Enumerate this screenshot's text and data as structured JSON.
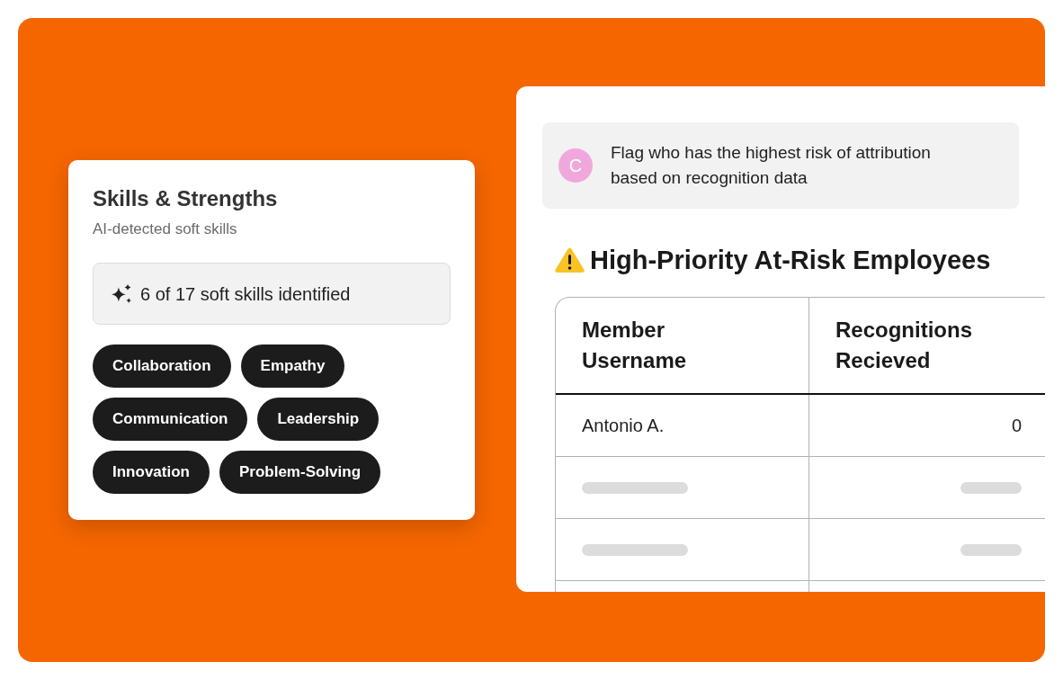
{
  "skills_card": {
    "title": "Skills & Strengths",
    "subtitle": "AI-detected soft skills",
    "summary": "6 of 17 soft skills identified",
    "skills": [
      "Collaboration",
      "Empathy",
      "Communication",
      "Leadership",
      "Innovation",
      "Problem-Solving"
    ]
  },
  "report_panel": {
    "prompt": {
      "avatar": "C",
      "text": "Flag who has the highest risk of attribution based on recognition data"
    },
    "heading": "High-Priority At-Risk Employees",
    "table": {
      "columns": [
        "Member Username",
        "Recognitions Recieved"
      ],
      "rows": [
        {
          "kind": "data",
          "cells": [
            "Antonio A.",
            "0"
          ]
        },
        {
          "kind": "skeleton"
        },
        {
          "kind": "skeleton"
        }
      ]
    }
  }
}
